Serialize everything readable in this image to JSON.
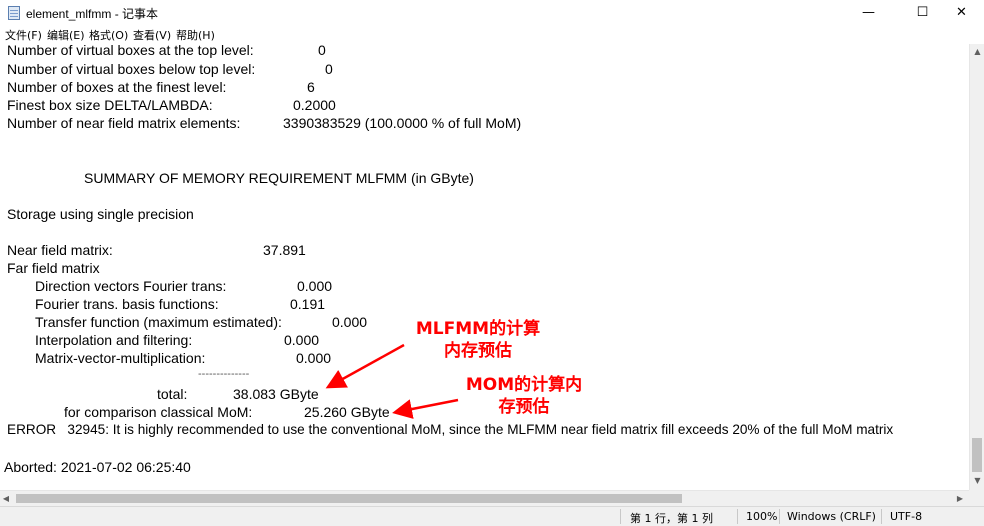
{
  "window": {
    "title": "element_mlfmm - 记事本",
    "min_glyph": "—",
    "max_glyph": "☐",
    "close_glyph": "✕"
  },
  "menu": [
    "文件(F)",
    "编辑(E)",
    "格式(O)",
    "查看(V)",
    "帮助(H)"
  ],
  "content": {
    "l1_label": "Number of virtual boxes at the top level:",
    "l1_value": "0",
    "l2_label": "Number of virtual boxes below top level:",
    "l2_value": "0",
    "l3_label": "Number of boxes at the finest level:",
    "l3_value": "6",
    "l4_label": "Finest box size DELTA/LAMBDA:",
    "l4_value": "0.2000",
    "l5_label": "Number of near field matrix elements:",
    "l5_value": "3390383529 (100.0000 % of full MoM)",
    "summary_heading": "SUMMARY OF MEMORY REQUIREMENT MLFMM (in GByte)",
    "storage": "Storage using single precision",
    "near_label": "Near field matrix:",
    "near_value": "37.891",
    "far_label": "Far field matrix",
    "dir_label": "Direction vectors Fourier trans:",
    "dir_value": "0.000",
    "basis_label": "Fourier trans. basis functions:",
    "basis_value": "0.191",
    "transfer_label": "Transfer function (maximum estimated):",
    "transfer_value": "0.000",
    "interp_label": "Interpolation and filtering:",
    "interp_value": "0.000",
    "mvm_label": "Matrix-vector-multiplication:",
    "mvm_value": "0.000",
    "dashes": "--------------",
    "total_label": "total:",
    "total_value": "38.083 GByte",
    "mom_label": "for comparison classical MoM:",
    "mom_value": "25.260 GByte",
    "error_line": "ERROR   32945: It is highly recommended to use the conventional MoM, since the MLFMM near field matrix fill exceeds 20% of the full MoM matrix",
    "aborted": "Aborted: 2021-07-02 06:25:40"
  },
  "annotations": {
    "mlfmm_note": "MLFMM的计算\n内存预估",
    "mom_note": "MOM的计算内\n存预估",
    "color": "#ff0000"
  },
  "status": {
    "position": "第 1 行，第 1 列",
    "zoom": "100%",
    "line_ending": "Windows (CRLF)",
    "encoding": "UTF-8"
  }
}
